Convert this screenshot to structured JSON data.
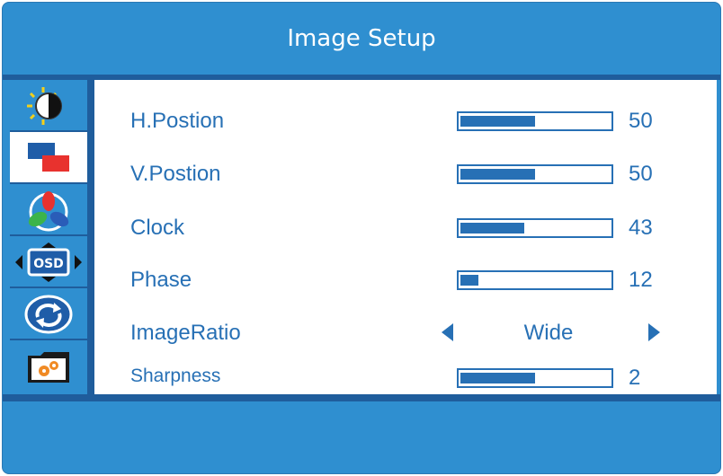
{
  "title": "Image Setup",
  "sidebar": {
    "items": [
      {
        "icon": "brightness-contrast-icon"
      },
      {
        "icon": "image-setup-icon"
      },
      {
        "icon": "color-icon"
      },
      {
        "icon": "osd-icon"
      },
      {
        "icon": "reset-icon"
      },
      {
        "icon": "settings-icon"
      }
    ],
    "active_index": 1
  },
  "settings": {
    "h_position": {
      "label": "H.Postion",
      "value": "50",
      "level": 50
    },
    "v_position": {
      "label": "V.Postion",
      "value": "50",
      "level": 50
    },
    "clock": {
      "label": "Clock",
      "value": "43",
      "level": 43
    },
    "phase": {
      "label": "Phase",
      "value": "12",
      "level": 12
    },
    "image_ratio": {
      "label": "ImageRatio",
      "value": "Wide"
    },
    "sharpness": {
      "label": "Sharpness",
      "value": "2",
      "level": 50
    }
  },
  "colors": {
    "background": "#2f8fd0",
    "accent": "#2770b5",
    "separator": "#1f5d9c"
  }
}
